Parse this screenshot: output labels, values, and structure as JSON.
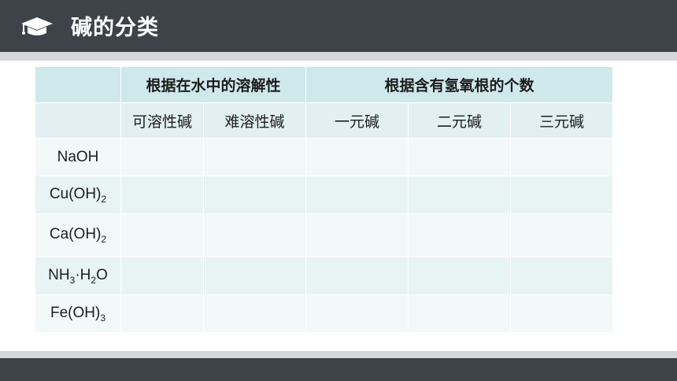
{
  "slide": {
    "title": "碱的分类",
    "icon": "graduation-cap-icon"
  },
  "table": {
    "group_headers": {
      "solubility": "根据在水中的溶解性",
      "hydroxide_count": "根据含有氢氧根的个数"
    },
    "sub_headers": [
      "可溶性碱",
      "难溶性碱",
      "一元碱",
      "二元碱",
      "三元碱"
    ],
    "rows": [
      {
        "name": "NaOH",
        "cells": [
          "",
          "",
          "",
          "",
          ""
        ]
      },
      {
        "name": "Cu(OH)2",
        "cells": [
          "",
          "",
          "",
          "",
          ""
        ]
      },
      {
        "name": "Ca(OH)2",
        "cells": [
          "",
          "",
          "",
          "",
          ""
        ]
      },
      {
        "name": "NH3·H2O",
        "cells": [
          "",
          "",
          "",
          "",
          ""
        ]
      },
      {
        "name": "Fe(OH)3",
        "cells": [
          "",
          "",
          "",
          "",
          ""
        ]
      }
    ]
  },
  "colors": {
    "header_bar": "#3d4349",
    "stripe": "#d6d7d9",
    "table_header": "#cfe8ec",
    "table_row_light": "#f3f8f8",
    "table_row_alt": "#e8f3f4"
  }
}
